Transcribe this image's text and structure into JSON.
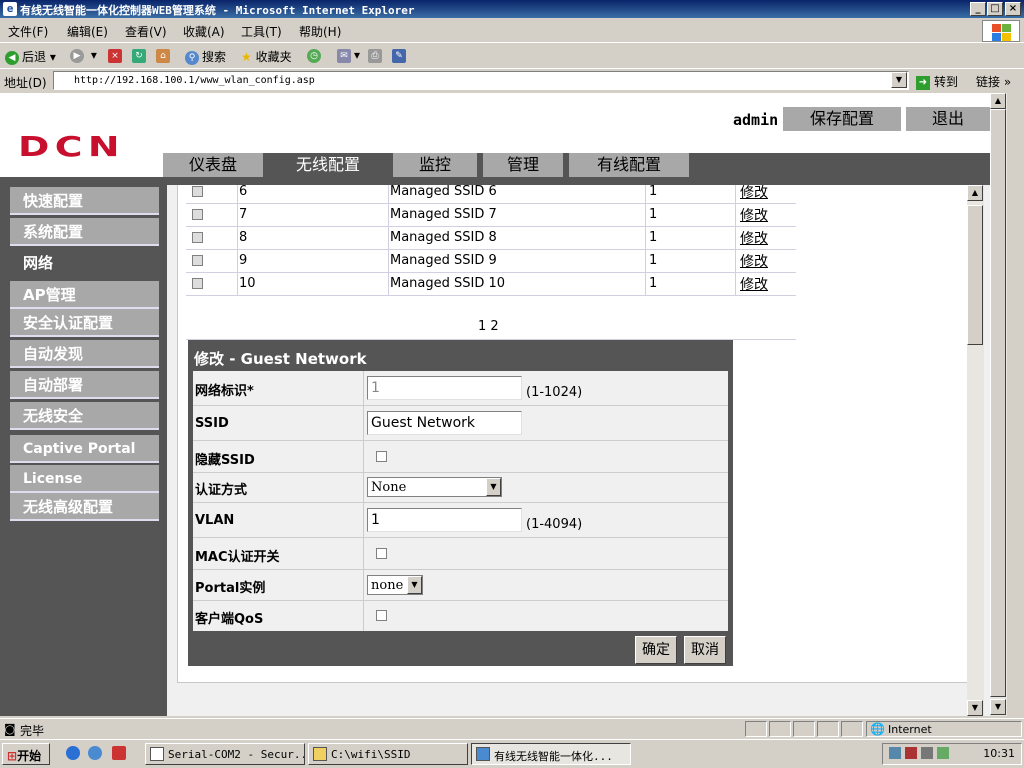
{
  "window": {
    "title": "有线无线智能一体化控制器WEB管理系统 - Microsoft Internet Explorer"
  },
  "menu": [
    "文件(F)",
    "编辑(E)",
    "查看(V)",
    "收藏(A)",
    "工具(T)",
    "帮助(H)"
  ],
  "toolbar": {
    "back": "后退",
    "search": "搜索",
    "favorites": "收藏夹"
  },
  "address": {
    "label": "地址(D)",
    "url": "http://192.168.100.1/www_wlan_config.asp",
    "go": "转到",
    "links": "链接"
  },
  "header": {
    "logo": "DCN",
    "user": "admin",
    "save": "保存配置",
    "logout": "退出"
  },
  "nav": {
    "tabs": [
      "仪表盘",
      "无线配置",
      "监控",
      "管理",
      "有线配置"
    ],
    "active": "无线配置"
  },
  "sidebar": {
    "items": [
      "快速配置",
      "系统配置",
      "网络",
      "AP管理",
      "安全认证配置",
      "自动发现",
      "自动部署",
      "无线安全",
      "Captive Portal",
      "License",
      "无线高级配置"
    ],
    "current": "网络"
  },
  "ssid_table": {
    "rows": [
      {
        "id": "6",
        "ssid": "Managed SSID 6",
        "vlan": "1",
        "action": "修改"
      },
      {
        "id": "7",
        "ssid": "Managed SSID 7",
        "vlan": "1",
        "action": "修改"
      },
      {
        "id": "8",
        "ssid": "Managed SSID 8",
        "vlan": "1",
        "action": "修改"
      },
      {
        "id": "9",
        "ssid": "Managed SSID 9",
        "vlan": "1",
        "action": "修改"
      },
      {
        "id": "10",
        "ssid": "Managed SSID 10",
        "vlan": "1",
        "action": "修改"
      }
    ],
    "pager": "1 2"
  },
  "edit_form": {
    "title": "修改 - Guest Network",
    "network_id_label": "网络标识*",
    "network_id_value": "1",
    "network_id_hint": "(1-1024)",
    "ssid_label": "SSID",
    "ssid_value": "Guest Network",
    "hide_ssid_label": "隐藏SSID",
    "auth_label": "认证方式",
    "auth_value": "None",
    "vlan_label": "VLAN",
    "vlan_value": "1",
    "vlan_hint": "(1-4094)",
    "mac_auth_label": "MAC认证开关",
    "portal_label": "Portal实例",
    "portal_value": "none",
    "qos_label": "客户端QoS",
    "ok": "确定",
    "cancel": "取消"
  },
  "status": {
    "text": "完毕",
    "zone": "Internet"
  },
  "taskbar": {
    "start": "开始",
    "tasks": [
      "Serial-COM2 - Secur...",
      "C:\\wifi\\SSID",
      "有线无线智能一体化..."
    ],
    "clock": "10:31"
  }
}
